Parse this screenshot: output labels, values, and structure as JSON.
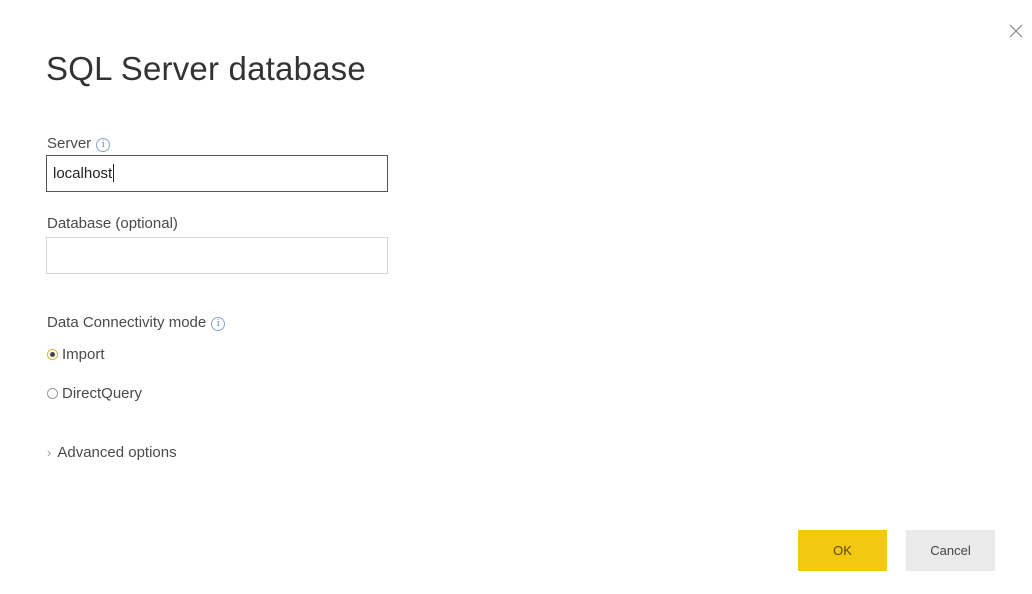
{
  "dialog": {
    "title": "SQL Server database",
    "close_icon": "close-icon"
  },
  "server": {
    "label": "Server",
    "value": "localhost",
    "info_icon": "info-icon"
  },
  "database": {
    "label": "Database (optional)",
    "value": ""
  },
  "connectivity": {
    "label": "Data Connectivity mode",
    "info_icon": "info-icon",
    "options": [
      {
        "label": "Import",
        "selected": true
      },
      {
        "label": "DirectQuery",
        "selected": false
      }
    ]
  },
  "advanced": {
    "label": "Advanced options",
    "icon": "chevron-right-icon"
  },
  "buttons": {
    "ok_label": "OK",
    "cancel_label": "Cancel"
  },
  "colors": {
    "accent": "#f2c811",
    "secondary_button": "#eaeaea"
  }
}
